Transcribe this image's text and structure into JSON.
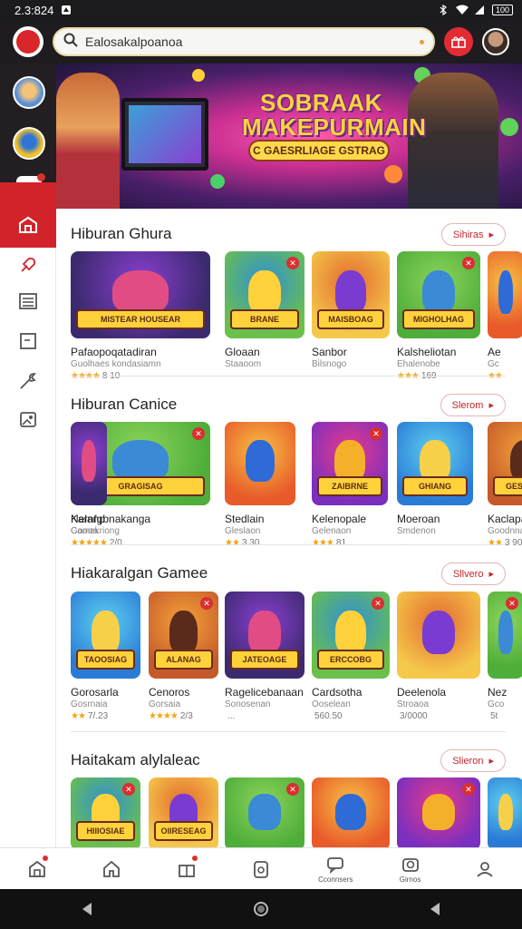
{
  "status_bar": {
    "time": "2.3:824",
    "battery": "100"
  },
  "search": {
    "query": "Ealosakalpoanoa"
  },
  "banner": {
    "title_line1": "SOBRAAK",
    "title_line2": "MAKEPURMAIN",
    "subtitle": "C GAESRLIAGE GSTRAG"
  },
  "colors": {
    "accent": "#d2232a",
    "topbar": "#1e1c1f",
    "stars": "#f2a516"
  },
  "sections": [
    {
      "title": "Hiburan Ghura",
      "more_label": "Sihiras",
      "cards": [
        {
          "name": "Pafaopoqatadiran",
          "sub": "Guolhaes kondasiamn",
          "stars": "★★★★",
          "rating": "8 10",
          "art": "MISTEAR HOUSEAR"
        },
        {
          "name": "Gloaan",
          "sub": "Staaoom",
          "stars": "",
          "rating": "",
          "art": "BRANE"
        },
        {
          "name": "Sanbor",
          "sub": "Bilsnogo",
          "stars": "",
          "rating": "",
          "art": "MAISBOAG"
        },
        {
          "name": "Kalsheliotan",
          "sub": "Ehalenobe",
          "stars": "★★★",
          "rating": "169",
          "art": "MIGHOLHAG"
        },
        {
          "name": "Ae",
          "sub": "Gc",
          "stars": "★★",
          "rating": "",
          "art": ""
        }
      ]
    },
    {
      "title": "Hiburan Canice",
      "more_label": "Slerom",
      "cards": [
        {
          "name": "Karnfgbnakanga",
          "sub": "Camekriong",
          "stars": "★★★★★",
          "rating": "2/0",
          "art": "GRAGISAG"
        },
        {
          "name": "Stedlain",
          "sub": "Gleslaon",
          "stars": "★★",
          "rating": "3 30",
          "art": ""
        },
        {
          "name": "Kelenopale",
          "sub": "Gelenaon",
          "stars": "★★★",
          "rating": "81",
          "art": "ZAIBRNE"
        },
        {
          "name": "Moeroan",
          "sub": "Smdenon",
          "stars": "",
          "rating": "...",
          "art": "GHIANG"
        },
        {
          "name": "Kaclapan",
          "sub": "Goodnnaa",
          "stars": "★★",
          "rating": "3 900",
          "art": "GESCHES"
        },
        {
          "name": "Nelanp",
          "sub": "Goooa",
          "stars": "★★",
          "rating": "",
          "art": ""
        }
      ]
    },
    {
      "title": "Hiakaralgan Gamee",
      "more_label": "Sllvero",
      "cards": [
        {
          "name": "Gorosarla",
          "sub": "Gosrnaia",
          "stars": "★★",
          "rating": "7/.23",
          "art": "TAOOSIAG"
        },
        {
          "name": "Cenoros",
          "sub": "Gorsaia",
          "stars": "★★★★",
          "rating": "2/3",
          "art": "ALANAG"
        },
        {
          "name": "Ragelicebanaan",
          "sub": "Sonosenan",
          "stars": "",
          "rating": "...",
          "art": "JATEOAGE"
        },
        {
          "name": "Cardsotha",
          "sub": "Ooselean",
          "stars": "",
          "rating": "560.50",
          "art": "ERCCOBG"
        },
        {
          "name": "Deelenola",
          "sub": "Stroaoa",
          "stars": "",
          "rating": "3/0000",
          "art": ""
        },
        {
          "name": "Nez",
          "sub": "Gco",
          "stars": "",
          "rating": "5t",
          "art": ""
        }
      ]
    },
    {
      "title": "Haitakam alylaleac",
      "more_label": "Slieron",
      "cards": [
        {
          "name": "",
          "sub": "",
          "stars": "",
          "rating": "",
          "art": "HIIIOSIAE"
        },
        {
          "name": "",
          "sub": "",
          "stars": "",
          "rating": "",
          "art": "OIIRESEAG"
        },
        {
          "name": "",
          "sub": "",
          "stars": "",
          "rating": "",
          "art": ""
        },
        {
          "name": "",
          "sub": "",
          "stars": "",
          "rating": "",
          "art": ""
        },
        {
          "name": "",
          "sub": "",
          "stars": "",
          "rating": "",
          "art": ""
        },
        {
          "name": "",
          "sub": "",
          "stars": "",
          "rating": "",
          "art": ""
        }
      ]
    }
  ],
  "bottom_nav": [
    {
      "icon": "store-icon",
      "label": ""
    },
    {
      "icon": "home-icon",
      "label": ""
    },
    {
      "icon": "gift-icon",
      "label": ""
    },
    {
      "icon": "games-icon",
      "label": ""
    },
    {
      "icon": "chat-icon",
      "label": "Cconnsers"
    },
    {
      "icon": "camera-icon",
      "label": "Girnos"
    },
    {
      "icon": "profile-icon",
      "label": ""
    }
  ]
}
